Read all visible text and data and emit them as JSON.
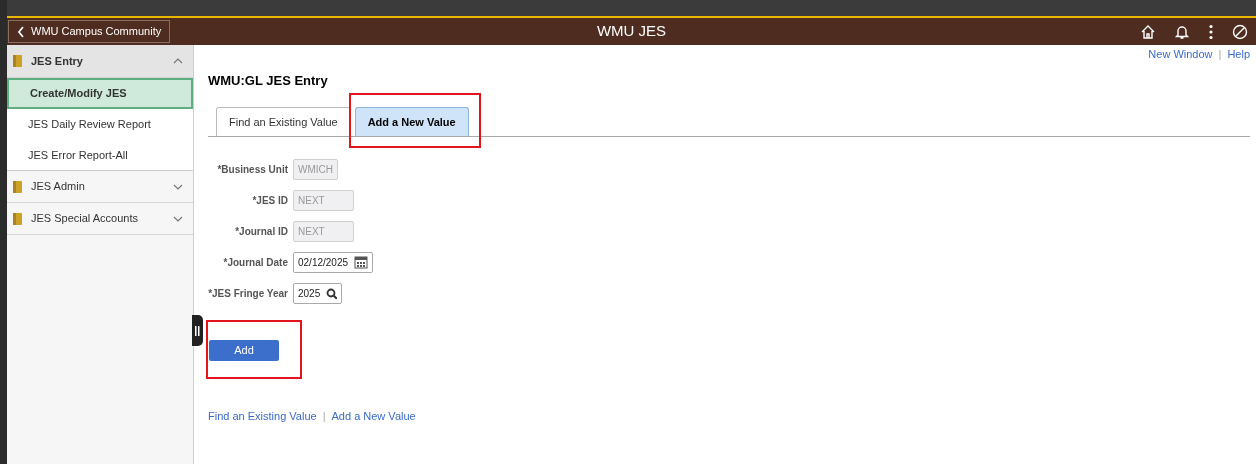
{
  "header": {
    "back_label": "WMU Campus Community",
    "title": "WMU JES"
  },
  "sidebar": {
    "items": [
      {
        "label": "JES Entry",
        "expanded": true,
        "children": [
          {
            "label": "Create/Modify JES",
            "selected": true
          },
          {
            "label": "JES Daily Review Report",
            "selected": false
          },
          {
            "label": "JES Error Report-All",
            "selected": false
          }
        ]
      },
      {
        "label": "JES Admin",
        "expanded": false
      },
      {
        "label": "JES Special Accounts",
        "expanded": false
      }
    ]
  },
  "top_links": {
    "items": [
      "New Window",
      "Help"
    ],
    "separator": "|"
  },
  "page_title": "WMU:GL JES Entry",
  "tabs": [
    {
      "label": "Find an Existing Value",
      "selected": false,
      "highlighted": false
    },
    {
      "label": "Add a New Value",
      "selected": true,
      "highlighted": true
    }
  ],
  "fields": [
    {
      "label": "*Business Unit",
      "value": "WMICH",
      "kind": "readonly"
    },
    {
      "label": "*JES ID",
      "value": "NEXT",
      "kind": "readonly"
    },
    {
      "label": "*Journal ID",
      "value": "NEXT",
      "kind": "readonly"
    },
    {
      "label": "*Journal Date",
      "value": "02/12/2025",
      "kind": "date"
    },
    {
      "label": "*JES Fringe Year",
      "value": "2025",
      "kind": "lookup"
    }
  ],
  "add_button": {
    "label": "Add",
    "highlighted": true
  },
  "bottom_links": {
    "items": [
      "Find an Existing Value",
      "Add a New Value"
    ],
    "separator": "|"
  }
}
